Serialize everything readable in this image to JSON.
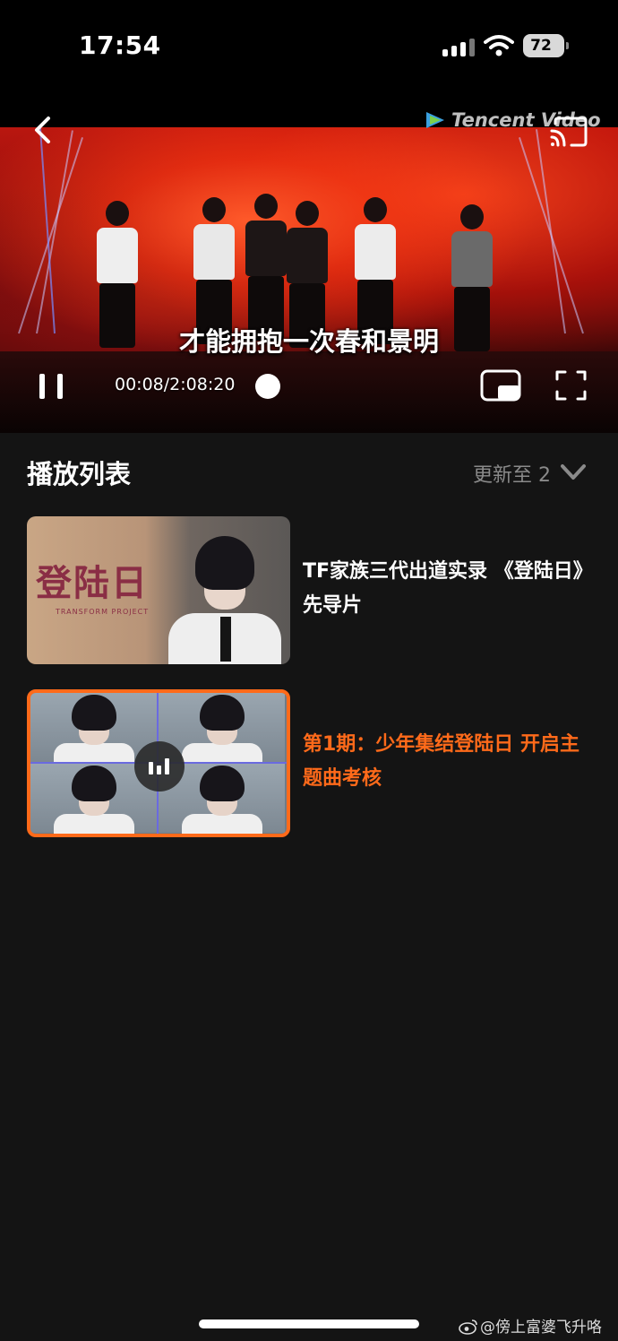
{
  "status_bar": {
    "time": "17:54",
    "battery": "72"
  },
  "player": {
    "brand": "Tencent Video",
    "subtitle": "才能拥抱一次春和景明",
    "time": "00:08/2:08:20",
    "accent_color": "#ff6a1a"
  },
  "playlist": {
    "title": "播放列表",
    "update_status": "更新至 2",
    "episodes": [
      {
        "title": "TF家族三代出道实录 《登陆日》先导片",
        "thumb_logo": "登陆日",
        "thumb_sub": "TRANSFORM PROJECT",
        "active": false
      },
      {
        "title": "第1期：少年集结登陆日 开启主题曲考核",
        "active": true
      }
    ]
  },
  "watermark": "@傍上富婆飞升咯",
  "icons": [
    "back-icon",
    "cast-icon",
    "pause-icon",
    "pip-icon",
    "fullscreen-icon",
    "chevron-down-icon",
    "playing-icon",
    "weibo-icon",
    "signal-icon",
    "wifi-icon"
  ]
}
